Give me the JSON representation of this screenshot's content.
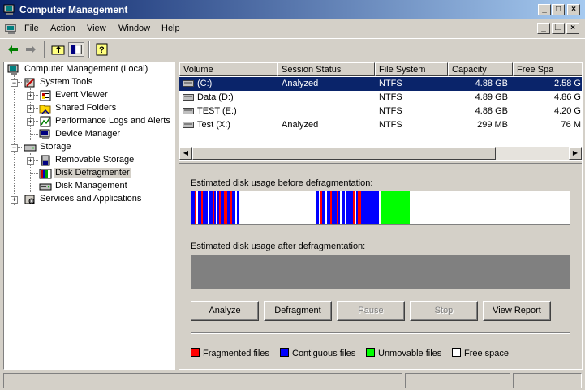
{
  "window": {
    "title": "Computer Management",
    "app_icon": "computer-management-icon",
    "caption_buttons": [
      "minimize",
      "maximize",
      "close"
    ]
  },
  "menu": {
    "items": [
      {
        "label": "File",
        "icon": null
      },
      {
        "label": "Action"
      },
      {
        "label": "View"
      },
      {
        "label": "Window"
      },
      {
        "label": "Help"
      }
    ],
    "mdi_buttons": [
      "minimize",
      "restore",
      "close"
    ]
  },
  "toolbar": {
    "buttons": [
      "back-arrow-icon",
      "forward-arrow-icon",
      "up-level-icon",
      "show-hide-tree-icon",
      "help-icon"
    ]
  },
  "tree": {
    "nodes": [
      {
        "label": "Computer Management (Local)",
        "icon": "computer-management-icon",
        "expander": ""
      },
      {
        "label": "System Tools",
        "icon": "system-tools-icon",
        "expander": "−"
      },
      {
        "label": "Event Viewer",
        "icon": "event-viewer-icon",
        "expander": "+"
      },
      {
        "label": "Shared Folders",
        "icon": "shared-folders-icon",
        "expander": "+"
      },
      {
        "label": "Performance Logs and Alerts",
        "icon": "performance-logs-icon",
        "expander": "+"
      },
      {
        "label": "Device Manager",
        "icon": "device-manager-icon",
        "expander": ""
      },
      {
        "label": "Storage",
        "icon": "storage-icon",
        "expander": "−"
      },
      {
        "label": "Removable Storage",
        "icon": "removable-storage-icon",
        "expander": "+"
      },
      {
        "label": "Disk Defragmenter",
        "icon": "disk-defragmenter-icon",
        "expander": "",
        "selected": true
      },
      {
        "label": "Disk Management",
        "icon": "disk-management-icon",
        "expander": ""
      },
      {
        "label": "Services and Applications",
        "icon": "services-applications-icon",
        "expander": "+"
      }
    ]
  },
  "volumes": {
    "columns": [
      "Volume",
      "Session Status",
      "File System",
      "Capacity",
      "Free Spa"
    ],
    "rows": [
      {
        "volume": "(C:)",
        "status": "Analyzed",
        "fs": "NTFS",
        "capacity": "4.88 GB",
        "free": "2.58 G",
        "selected": true
      },
      {
        "volume": "Data (D:)",
        "status": "",
        "fs": "NTFS",
        "capacity": "4.89 GB",
        "free": "4.86 G"
      },
      {
        "volume": "TEST (E:)",
        "status": "",
        "fs": "NTFS",
        "capacity": "4.88 GB",
        "free": "4.20 G"
      },
      {
        "volume": "Test (X:)",
        "status": "Analyzed",
        "fs": "NTFS",
        "capacity": "299 MB",
        "free": "76 M"
      }
    ]
  },
  "defrag": {
    "before_label": "Estimated disk usage before defragmentation:",
    "after_label": "Estimated disk usage after defragmentation:",
    "buttons": [
      {
        "label": "Analyze",
        "enabled": true
      },
      {
        "label": "Defragment",
        "enabled": true
      },
      {
        "label": "Pause",
        "enabled": false
      },
      {
        "label": "Stop",
        "enabled": false
      },
      {
        "label": "View Report",
        "enabled": true
      }
    ],
    "legend": [
      {
        "label": "Fragmented files",
        "color": "#ff0000"
      },
      {
        "label": "Contiguous files",
        "color": "#0000ff"
      },
      {
        "label": "Unmovable files",
        "color": "#00ff00"
      },
      {
        "label": "Free space",
        "color": "#ffffff"
      }
    ],
    "before_map": [
      {
        "from": 0.0,
        "to": 0.125,
        "kind": "mixed"
      },
      {
        "from": 0.125,
        "to": 0.2,
        "kind": "free"
      },
      {
        "from": 0.2,
        "to": 0.328,
        "kind": "free"
      },
      {
        "from": 0.328,
        "to": 0.5,
        "kind": "mixed"
      },
      {
        "from": 0.5,
        "to": 0.577,
        "kind": "unmovable"
      },
      {
        "from": 0.577,
        "to": 1.0,
        "kind": "free"
      }
    ]
  },
  "statusbar": {
    "panes": [
      "",
      "",
      ""
    ]
  }
}
